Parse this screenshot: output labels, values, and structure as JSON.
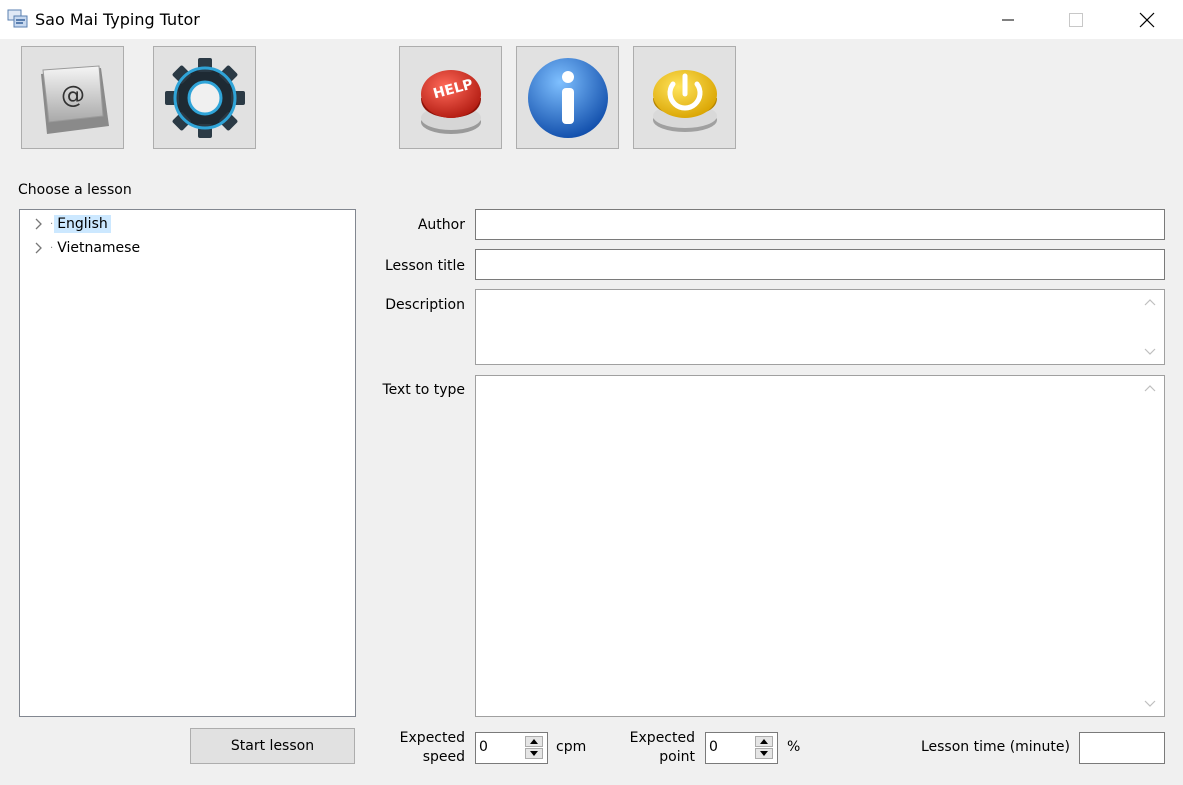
{
  "window": {
    "title": "Sao Mai Typing Tutor"
  },
  "toolbar": {
    "icons": [
      "keyboard-key-icon",
      "settings-gear-icon",
      "help-button-icon",
      "info-icon",
      "power-exit-icon"
    ],
    "help_icon_text": "HELP"
  },
  "lesson_tree": {
    "label": "Choose a lesson",
    "items": [
      {
        "label": "English",
        "selected": true
      },
      {
        "label": "Vietnamese",
        "selected": false
      }
    ]
  },
  "form": {
    "author_label": "Author",
    "author_value": "",
    "title_label": "Lesson title",
    "title_value": "",
    "description_label": "Description",
    "description_value": "",
    "text_label": "Text to type",
    "text_value": ""
  },
  "footer": {
    "start_button": "Start lesson",
    "speed_label_line1": "Expected",
    "speed_label_line2": "speed",
    "speed_value": "0",
    "speed_unit": "cpm",
    "point_label_line1": "Expected",
    "point_label_line2": "point",
    "point_value": "0",
    "point_unit": "%",
    "time_label": "Lesson time (minute)",
    "time_value": ""
  },
  "colors": {
    "window_bg": "#f0f0f0",
    "selection": "#cce8ff",
    "help_red": "#d42a1e",
    "info_blue": "#1f6fd0",
    "power_yellow": "#f2c200"
  }
}
